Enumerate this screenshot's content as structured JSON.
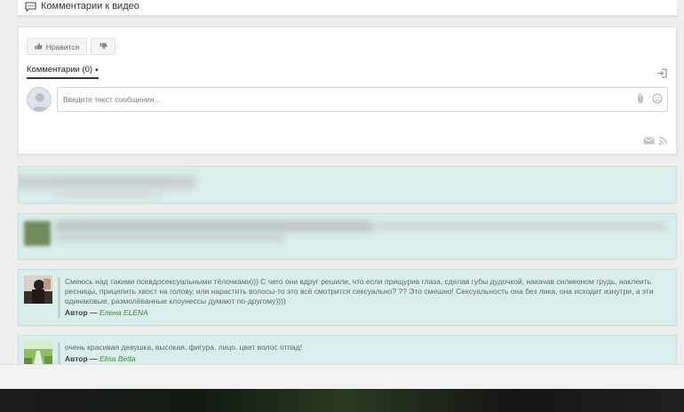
{
  "header": {
    "title": "Комментарии к видео",
    "icon": "comment-icon"
  },
  "vote": {
    "like_label": "Нравится",
    "like_icon": "thumbs-up-icon",
    "dislike_icon": "thumbs-down-icon"
  },
  "comments_tab": {
    "label": "Комментарии (0)",
    "caret": "▾"
  },
  "comment_form": {
    "placeholder": "Введите текст сообщения...",
    "icons": [
      "attach-icon",
      "smile-icon",
      "mail-icon",
      "rss-icon",
      "login-icon"
    ]
  },
  "comments": [
    {
      "text": "Смеюсь над такими псевдосексуальными тёлочками))) С чего они вдруг решили, что если прищурив глаза, сделав губы дудочкой, накачав силиконом грудь, наклеить ресницы, прицепить хвост на голову, или нарастить волосы-то это всё смотрится сексуально? ?? Это смешно! Сексуальность она без лика, она исходит изнутри, а эти одинаковые, размолёванные клоунессы думают по-другому))))",
      "author_label": "Автор —",
      "author": "Елена ELENA"
    },
    {
      "text": "очень красивая девушка, высокая, фигура, лицо. цвет волос отпад!",
      "author_label": "Автор —",
      "author": "Elisa Betta"
    }
  ],
  "colors": {
    "card_bg": "#daeeed",
    "author_link": "#3f8a3a"
  }
}
